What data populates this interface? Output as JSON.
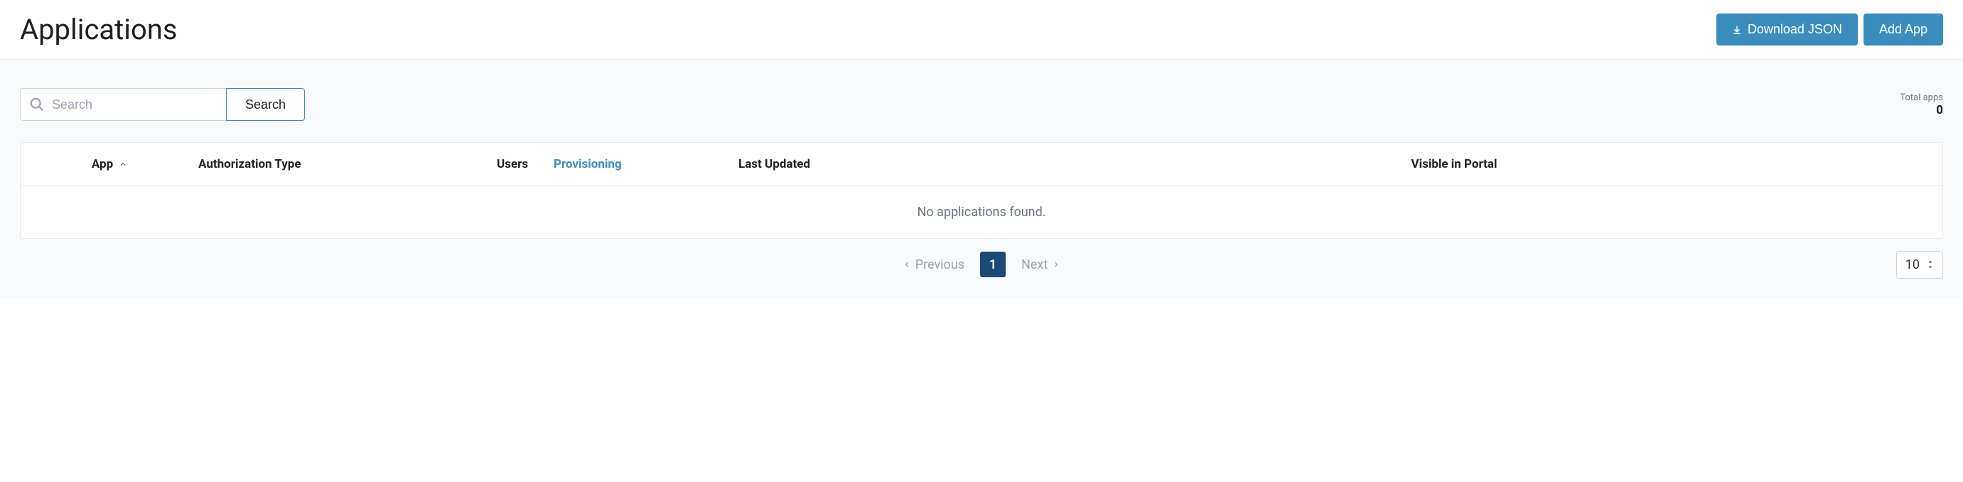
{
  "header": {
    "title": "Applications",
    "download_json_label": "Download JSON",
    "add_app_label": "Add App"
  },
  "search": {
    "placeholder": "Search",
    "button_label": "Search"
  },
  "totals": {
    "label": "Total apps",
    "count": "0"
  },
  "table": {
    "columns": {
      "app": "App",
      "auth_type": "Authorization Type",
      "users": "Users",
      "provisioning": "Provisioning",
      "last_updated": "Last Updated",
      "visible_in_portal": "Visible in Portal"
    },
    "empty_message": "No applications found."
  },
  "pagination": {
    "previous_label": "Previous",
    "next_label": "Next",
    "current_page": "1",
    "page_size": "10"
  }
}
